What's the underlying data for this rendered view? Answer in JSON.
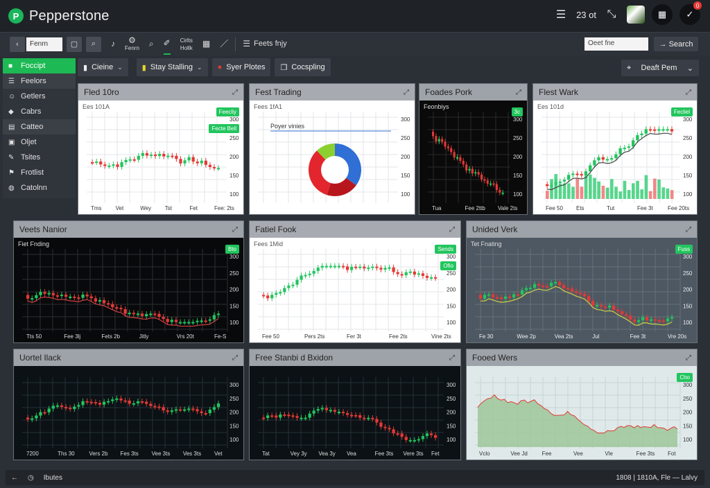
{
  "app": {
    "name": "Pepperstone",
    "logo_letter": "P"
  },
  "top_right": {
    "count_text": "23 ot",
    "notif_count": "0"
  },
  "toolbar": {
    "symbol_input": "Fenrn",
    "tools_label": "Fenrn",
    "indicators_top": "Cirlts",
    "indicators_bottom": "Hollk",
    "tab_label": "Feets fnjy",
    "search_placeholder": "Oeet fne",
    "search_button": "Search"
  },
  "sidebar": {
    "items": [
      {
        "label": "Foccipt",
        "icon": "dashboard-icon"
      },
      {
        "label": "Feelors",
        "icon": "list-icon"
      },
      {
        "label": "Getlers",
        "icon": "users-icon"
      },
      {
        "label": "Cabrs",
        "icon": "tag-icon"
      },
      {
        "label": "Catteo",
        "icon": "chart-icon"
      },
      {
        "label": "Oljet",
        "icon": "object-icon"
      },
      {
        "label": "Tsites",
        "icon": "pen-icon"
      },
      {
        "label": "Frotlist",
        "icon": "flag-icon"
      },
      {
        "label": "Catolnn",
        "icon": "globe-icon"
      }
    ]
  },
  "filters": [
    {
      "label": "Cieine",
      "icon": "doc-icon",
      "chev": true
    },
    {
      "label": "Stay Stalling",
      "icon": "yellow-box-icon",
      "chev": true
    },
    {
      "label": "Syer Plotes",
      "icon": "red-dot-icon",
      "chev": false
    },
    {
      "label": "Cocspling",
      "icon": "copy-icon",
      "chev": false
    }
  ],
  "draft": {
    "label": "Deaft Pem"
  },
  "panels": [
    {
      "title": "Fled 10ro",
      "subtitle": "Ees 101A",
      "tag1": "Feecliy",
      "tag2": "Fecte Bell",
      "xlabels": [
        "Tms",
        "Vet",
        "Wey",
        "Tst",
        "Fet",
        "Fee: 2ts"
      ]
    },
    {
      "title": "Fest Trading",
      "subtitle": "Fees 1fA1",
      "legend": "Poyer vinies"
    },
    {
      "title": "Foades Pork",
      "subtitle": "Feonbiys",
      "tag1": "3c",
      "xlabels": [
        "Tua",
        "Fee 2ttb",
        "Vale 2ts"
      ]
    },
    {
      "title": "Flest Wark",
      "subtitle": "Ees 101d",
      "tag1": "Fecliel",
      "xlabels": [
        "Fee 50",
        "Ets",
        "Tut",
        "Fee 3t",
        "Fee 20ts"
      ]
    },
    {
      "title": "Veets Nanior",
      "subtitle": "Fiet Fnding",
      "tag1": "Bto",
      "xlabels": [
        "Tts 50",
        "Fee 3lj",
        "Fets 2b",
        "Jitly",
        "Vrs 20t",
        "Fe-S"
      ]
    },
    {
      "title": "Fatiel Fook",
      "subtitle": "Fees 1Mid",
      "tag1": "Sends",
      "tag2": "Ofio",
      "xlabels": [
        "Fee 50",
        "Pers 2ts",
        "Fer 3t",
        "Fee 2ts",
        "Vine 2ts"
      ]
    },
    {
      "title": "Unided Verk",
      "subtitle": "Tet Fnating",
      "tag1": "Fuss",
      "xlabels": [
        "Fe 30",
        "Wee 2p",
        "Vea 2ts",
        "Jul",
        "Fee 3t",
        "Vre 20s"
      ]
    },
    {
      "title": "Uortel Ilack",
      "subtitle": "",
      "xlabels": [
        "7200",
        "Ths 30",
        "Vers 2b",
        "Fes 3ts",
        "Vee 3ts",
        "Ves 3ts",
        "Vet"
      ]
    },
    {
      "title": "Free Stanbi d Bxidon",
      "subtitle": "",
      "xlabels": [
        "Tat",
        "Vey 3y",
        "Vea 3y",
        "Vea",
        "Fee 3ts",
        "Vere 3ts",
        "Fet"
      ]
    },
    {
      "title": "Fooed Wers",
      "subtitle": "",
      "tag1": "Cho",
      "xlabels": [
        "Vclo",
        "Vee Jd",
        "Fee",
        "Vee",
        "Vle",
        "Fee 3ts",
        "Fot"
      ]
    }
  ],
  "pie_chart": {
    "slices": [
      {
        "value": 35,
        "color": "#2f6fd6"
      },
      {
        "value": 20,
        "color": "#b8161d"
      },
      {
        "value": 33,
        "color": "#e3262d"
      },
      {
        "value": 12,
        "color": "#8bd030"
      }
    ]
  },
  "statusbar": {
    "left": "Ibutes",
    "right": "1808 | 1810A, Fle — Lalvy"
  },
  "colors": {
    "accent": "#1db954",
    "up": "#22c55e",
    "down": "#e53935"
  }
}
